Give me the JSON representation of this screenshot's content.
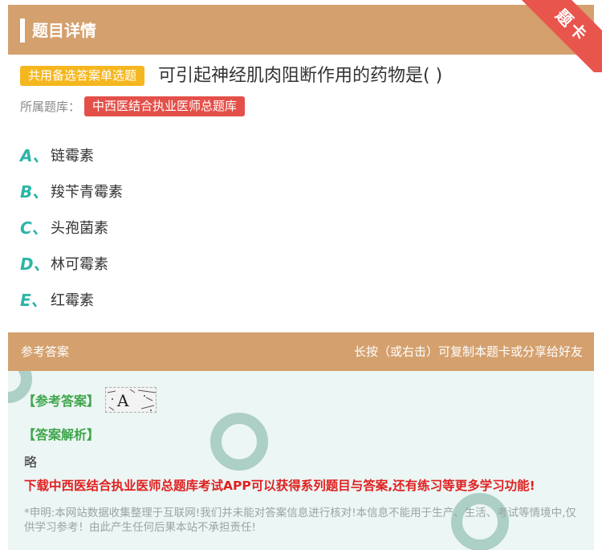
{
  "header": {
    "title": "题目详情",
    "ribbon": "题卡"
  },
  "question": {
    "type_tag": "共用备选答案单选题",
    "text": "可引起神经肌肉阻断作用的药物是( )",
    "bank_label": "所属题库：",
    "bank_name": "中西医结合执业医师总题库",
    "options": [
      {
        "letter": "A、",
        "text": "链霉素"
      },
      {
        "letter": "B、",
        "text": "羧苄青霉素"
      },
      {
        "letter": "C、",
        "text": "头孢菌素"
      },
      {
        "letter": "D、",
        "text": "林可霉素"
      },
      {
        "letter": "E、",
        "text": "红霉素"
      }
    ]
  },
  "answer": {
    "section_title": "参考答案",
    "hint": "长按（或右击）可复制本题卡或分享给好友",
    "answer_label": "【参考答案】",
    "answer_value": "A",
    "analysis_label": "【答案解析】",
    "analysis_text": "略",
    "download_text": "下载中西医结合执业医师总题库考试APP可以获得系列题目与答案,还有练习等更多学习功能!",
    "disclaimer": "*申明:本网站数据收集整理于互联网!我们并未能对答案信息进行核对!本信息不能用于生产、生活、考试等情境中,仅供学习参考！由此产生任何后果本站不承担责任!"
  },
  "colors": {
    "header_bg": "#d4a06e",
    "ribbon": "#e8554d",
    "tag_yellow": "#f5b71f",
    "tag_red": "#e35049",
    "option_letter": "#2bb5a8",
    "answer_green": "#3fa64c",
    "download_red": "#e02020"
  }
}
